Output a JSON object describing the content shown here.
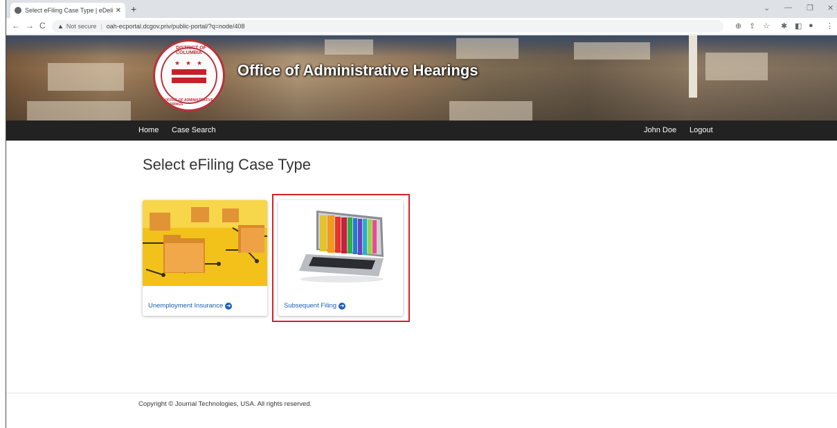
{
  "browser": {
    "tab_title": "Select eFiling Case Type | eDeliv",
    "tab_close": "✕",
    "new_tab": "+",
    "back": "←",
    "forward": "→",
    "reload": "C",
    "security_warning": "Not secure",
    "url": "oah-ecportal.dcgov.priv/public-portal/?q=node/408",
    "toolbar_icons": [
      "zoom-icon",
      "share-icon",
      "star-icon",
      "extensions-icon",
      "sidepanel-icon",
      "profile-icon",
      "menu-icon"
    ]
  },
  "banner": {
    "title": "Office of Administrative Hearings",
    "seal_text_top": "DISTRICT OF COLUMBIA",
    "seal_text_bottom": "OFFICE OF ADMINISTRATIVE HEARINGS"
  },
  "nav": {
    "home": "Home",
    "case_search": "Case Search",
    "user": "John Doe",
    "logout": "Logout"
  },
  "main": {
    "title": "Select eFiling Case Type",
    "cards": [
      {
        "label": "Unemployment Insurance",
        "image": "folders-circuit-image"
      },
      {
        "label": "Subsequent Filing",
        "image": "laptop-folders-image"
      }
    ]
  },
  "footer": {
    "copyright": "Copyright © Journal Technologies, USA. All rights reserved."
  },
  "colors": {
    "nav_bg": "#222222",
    "link": "#1a5fb4",
    "highlight": "#d61f26",
    "seal_red": "#b8323a"
  }
}
